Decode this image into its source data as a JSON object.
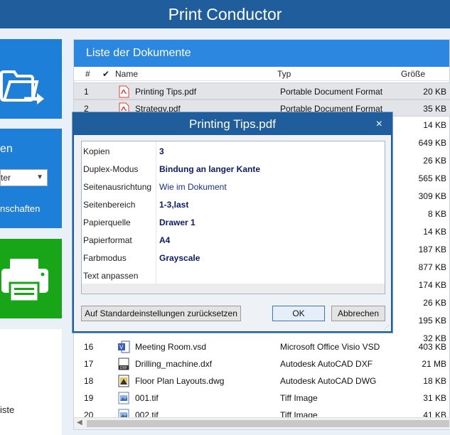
{
  "app_title": "Print Conductor",
  "sidebar": {
    "printer_label": "en",
    "printer_select_value": "ter",
    "properties_link": "nschaften",
    "list_label": "iste"
  },
  "document_list": {
    "title": "Liste der Dokumente",
    "columns": {
      "num": "#",
      "check": "✔",
      "name": "Name",
      "type": "Typ",
      "size": "Größe"
    },
    "rows_top": [
      {
        "num": "1",
        "name": "Printing Tips.pdf",
        "type": "Portable Document Format",
        "size": "20 KB",
        "icon": "pdf-icon"
      },
      {
        "num": "2",
        "name": "Strategy.pdf",
        "type": "Portable Document Format",
        "size": "35 KB",
        "icon": "pdf-icon"
      }
    ],
    "sizes_behind_dialog": [
      "14 KB",
      "649 KB",
      "26 KB",
      "565 KB",
      "309 KB",
      "8 KB",
      "14 KB",
      "187 KB",
      "877 KB",
      "174 KB",
      "26 KB",
      "195 KB",
      "32 KB"
    ],
    "rows_bottom": [
      {
        "num": "16",
        "name": "Meeting Room.vsd",
        "type": "Microsoft Office Visio VSD",
        "size": "403 KB",
        "icon": "visio-icon"
      },
      {
        "num": "17",
        "name": "Drilling_machine.dxf",
        "type": "Autodesk AutoCAD DXF",
        "size": "21 MB",
        "icon": "dxf-icon"
      },
      {
        "num": "18",
        "name": "Floor Plan Layouts.dwg",
        "type": "Autodesk AutoCAD DWG",
        "size": "18 KB",
        "icon": "dwg-icon"
      },
      {
        "num": "19",
        "name": "001.tif",
        "type": "Tiff Image",
        "size": "31 KB",
        "icon": "image-icon"
      },
      {
        "num": "20",
        "name": "002.tif",
        "type": "Tiff Image",
        "size": "41 KB",
        "icon": "image-icon"
      }
    ]
  },
  "dialog": {
    "title": "Printing Tips.pdf",
    "close": "×",
    "properties": [
      {
        "key": "Kopien",
        "value": "3",
        "bold": true
      },
      {
        "key": "Duplex-Modus",
        "value": "Bindung an langer Kante",
        "bold": true
      },
      {
        "key": "Seitenausrichtung",
        "value": "Wie im Dokument",
        "bold": false
      },
      {
        "key": "Seitenbereich",
        "value": "1-3,last",
        "bold": true
      },
      {
        "key": "Papierquelle",
        "value": "Drawer 1",
        "bold": true
      },
      {
        "key": "Papierformat",
        "value": "A4",
        "bold": true
      },
      {
        "key": "Farbmodus",
        "value": "Grayscale",
        "bold": true
      },
      {
        "key": "Text anpassen",
        "value": "",
        "bold": false
      }
    ],
    "reset_button": "Auf Standardeinstellungen zurücksetzen",
    "ok_button": "OK",
    "cancel_button": "Abbrechen"
  }
}
